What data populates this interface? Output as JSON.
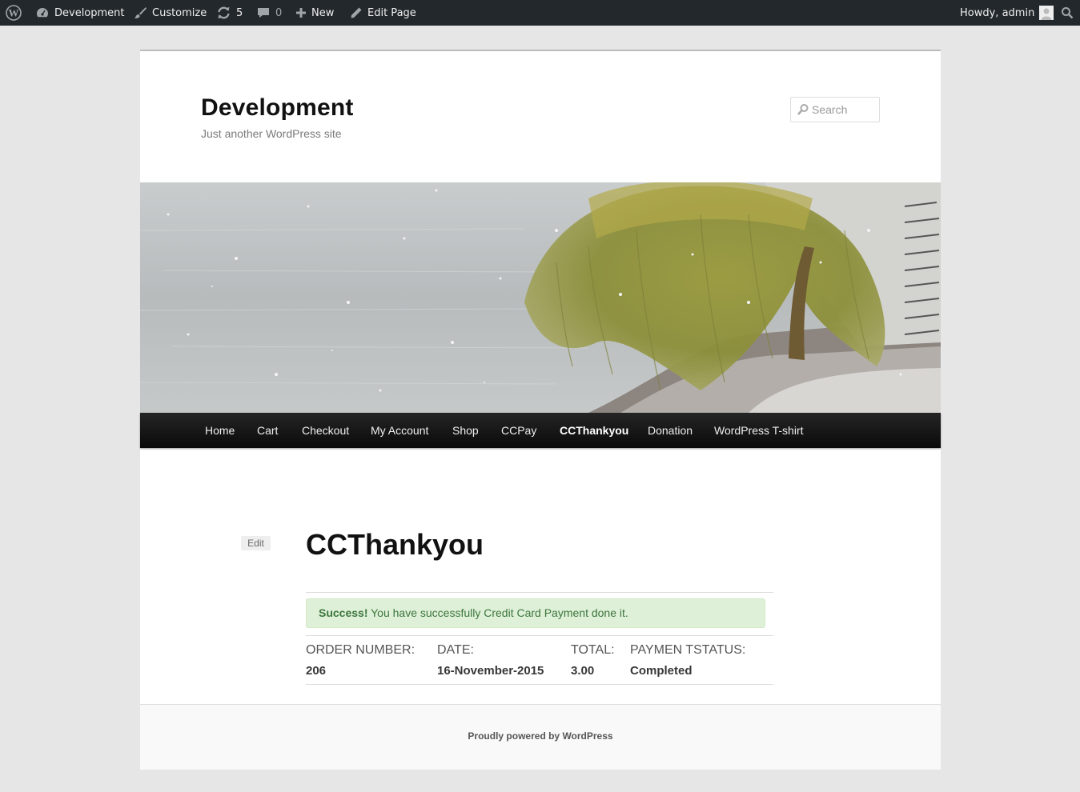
{
  "admin_bar": {
    "site_name": "Development",
    "customize": "Customize",
    "updates_count": "5",
    "comments_count": "0",
    "new_label": "New",
    "edit_page": "Edit Page",
    "howdy": "Howdy, admin"
  },
  "site": {
    "title": "Development",
    "description": "Just another WordPress site"
  },
  "search": {
    "placeholder": "Search"
  },
  "nav": {
    "items": [
      {
        "label": "Home"
      },
      {
        "label": "Cart"
      },
      {
        "label": "Checkout"
      },
      {
        "label": "My Account"
      },
      {
        "label": "Shop"
      },
      {
        "label": "CCPay"
      },
      {
        "label": "CCThankyou",
        "current": true
      },
      {
        "label": "Donation"
      },
      {
        "label": "WordPress T-shirt"
      }
    ]
  },
  "content": {
    "edit_label": "Edit",
    "title": "CCThankyou",
    "alert_strong": "Success!",
    "alert_text": "You have successfully Credit Card Payment done it.",
    "order": {
      "number_label": "ORDER NUMBER:",
      "number_value": "206",
      "date_label": "DATE:",
      "date_value": "16-November-2015",
      "total_label": "TOTAL:",
      "total_value": "3.00",
      "status_label": "PAYMEN TSTATUS:",
      "status_value": "Completed"
    }
  },
  "footer": {
    "credit": "Proudly powered by WordPress"
  },
  "colors": {
    "admin_bar": "#23282d",
    "nav": "#111111",
    "alert_bg": "#dff0d8",
    "alert_text": "#3c763d"
  },
  "icons": {
    "wp_logo": "wordpress-icon",
    "site": "dashboard-icon",
    "customize": "brush-icon",
    "updates": "refresh-icon",
    "comments": "comment-icon",
    "new": "plus-icon",
    "edit": "pencil-icon",
    "avatar": "avatar-icon",
    "search": "search-icon"
  }
}
